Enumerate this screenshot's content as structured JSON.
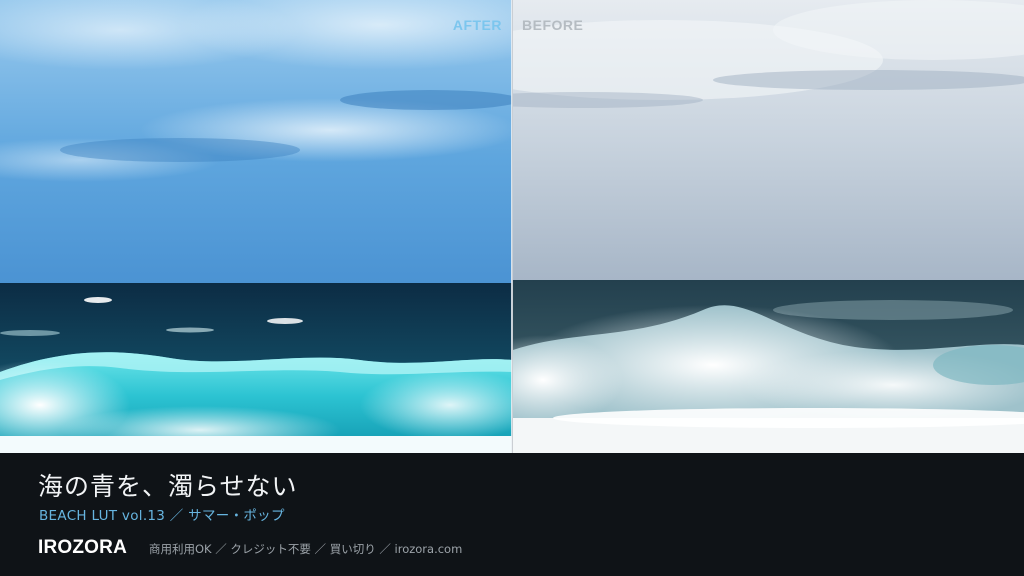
{
  "compare": {
    "after_label": "AFTER",
    "before_label": "BEFORE"
  },
  "caption": {
    "headline": "海の青を、濁らせない",
    "subline": "BEACH LUT vol.13 ／ サマー・ポップ",
    "brand": "IROZORA",
    "terms": "商用利用OK ／ クレジット不要 ／ 買い切り ／ irozora.com"
  },
  "colors": {
    "after_sky_top": "#8cc3ea",
    "after_sky_bottom": "#4f9ad8",
    "after_sea": "#103b52",
    "after_wave": "#3fd0dc",
    "before_sky_top": "#e4eaf0",
    "before_sky_bottom": "#a9b8c8",
    "before_sea": "#2c4a58",
    "before_wave": "#b9ced6",
    "accent_blue": "#67b5e0",
    "panel_bg": "#0f1317"
  }
}
